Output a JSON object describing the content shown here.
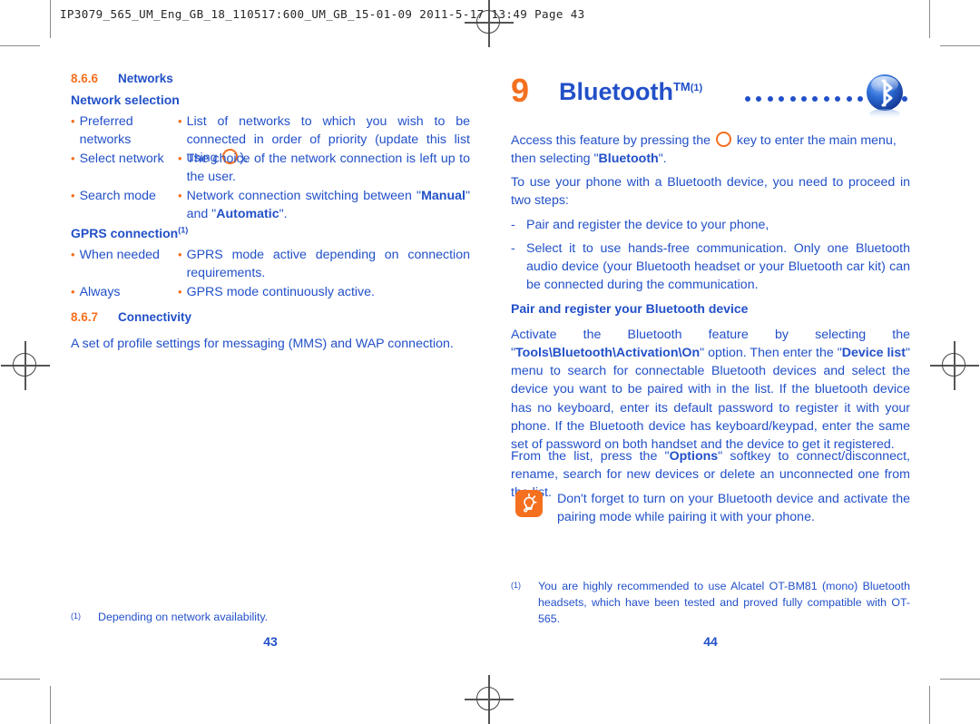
{
  "slug": "IP3079_565_UM_Eng_GB_18_110517:600_UM_GB_15-01-09   2011-5-17   13:49   Page 43",
  "colors": {
    "heading_blue": "#2250c8",
    "accent_orange": "#f4701f",
    "body_blue": "#2250c8"
  },
  "left_page": {
    "page_number": "43",
    "section_networks": {
      "number": "8.6.6",
      "title": "Networks"
    },
    "network_selection_title": "Network selection",
    "network_rows": [
      {
        "term": "Preferred networks",
        "desc_before": "List of networks to which you wish to be connected in order of priority (update this list using ",
        "has_key_icon": true,
        "desc_after": ")."
      },
      {
        "term": "Select network",
        "desc_before": "The choice of the network connection is left up to the user.",
        "has_key_icon": false,
        "desc_after": ""
      },
      {
        "term": "Search mode",
        "desc_before": "Network connection switching between \"",
        "bold_1": "Manual",
        "desc_mid": "\" and \"",
        "bold_2": "Automatic",
        "desc_after": "\".",
        "has_key_icon": false
      }
    ],
    "gprs_title": "GPRS connection",
    "gprs_footnote_mark": "(1)",
    "gprs_rows": [
      {
        "term": "When needed",
        "desc": "GPRS mode active depending on connection requirements."
      },
      {
        "term": "Always",
        "desc": "GPRS mode continuously active."
      }
    ],
    "section_connectivity": {
      "number": "8.6.7",
      "title": "Connectivity"
    },
    "connectivity_body": "A set of profile settings for messaging (MMS) and WAP connection.",
    "footnote": {
      "mark": "(1)",
      "text": "Depending on network availability."
    }
  },
  "right_page": {
    "page_number": "44",
    "chapter": {
      "number": "9",
      "title": "Bluetooth",
      "trademark": "TM",
      "footnote_mark": "(1)",
      "leader_dot_count": 15,
      "icon": "bluetooth-icon"
    },
    "intro": {
      "before_key": "Access this feature by pressing the ",
      "after_key": " key to enter the main menu, then selecting \"",
      "bold": "Bluetooth",
      "end": "\"."
    },
    "two_steps_intro": "To use your phone with a Bluetooth device, you need to proceed in two steps:",
    "steps": [
      "Pair and register the device to your phone,",
      "Select it to use hands-free communication. Only one Bluetooth audio device (your Bluetooth headset or your Bluetooth car kit) can be connected during the communication."
    ],
    "pair_title": "Pair and register your Bluetooth device",
    "pair_body": {
      "p1": "Activate the Bluetooth feature by selecting the \"",
      "b1": "Tools\\Bluetooth\\Activation\\On",
      "p2": "\" option. Then enter the \"",
      "b2": "Device list",
      "p3": "\" menu to search for connectable Bluetooth devices and select the device you want to be paired with in the list. If the bluetooth device has no keyboard, enter its default password to register it with your phone. If the Bluetooth device has keyboard/keypad, enter the same set of password on both handset and the device to get it registered."
    },
    "options_body": {
      "p1": "From the list, press the \"",
      "b1": "Options",
      "p2": "\" softkey to connect/disconnect, rename, search for new devices or delete an unconnected one from the list."
    },
    "tip": {
      "icon": "lightbulb-tip-icon",
      "text": "Don't forget to turn on your Bluetooth device and activate the pairing mode while pairing it with your phone."
    },
    "footnote": {
      "mark": "(1)",
      "text": "You are highly recommended to use Alcatel OT-BM81 (mono) Bluetooth headsets, which have been tested and proved fully compatible with OT-565."
    }
  }
}
